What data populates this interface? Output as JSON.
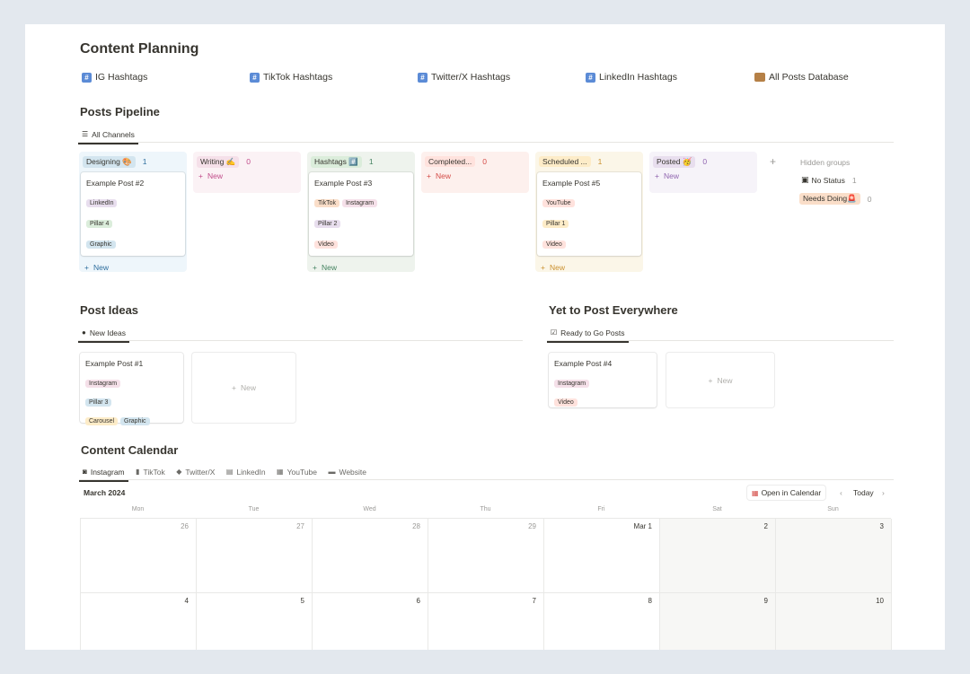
{
  "page_title": "Content Planning",
  "hashtag_links": [
    {
      "label": "IG Hashtags",
      "icon": "hashtag-icon"
    },
    {
      "label": "TikTok Hashtags",
      "icon": "hashtag-icon"
    },
    {
      "label": "Twitter/X Hashtags",
      "icon": "hashtag-icon"
    },
    {
      "label": "LinkedIn Hashtags",
      "icon": "hashtag-icon"
    },
    {
      "label": "All Posts Database",
      "icon": "card-file-box-icon"
    }
  ],
  "pipeline": {
    "title": "Posts Pipeline",
    "view_tab": "All Channels",
    "columns": [
      {
        "label": "Designing 🎨",
        "count": "1",
        "bg": "#eef6fb",
        "pill": "#d3e5ef",
        "color": "#2e6e9e",
        "cards": [
          {
            "title": "Example Post #2",
            "tags": [
              {
                "text": "LinkedIn",
                "bg": "#e8deee"
              },
              {
                "text": "Pillar 4",
                "bg": "#dbeddb"
              },
              {
                "text": "Graphic",
                "bg": "#d3e5ef"
              }
            ]
          }
        ]
      },
      {
        "label": "Writing ✍️",
        "count": "0",
        "bg": "#fbf2f5",
        "pill": "#f5e0e9",
        "color": "#c14c8a",
        "cards": []
      },
      {
        "label": "Hashtags #️⃣",
        "count": "1",
        "bg": "#eef3ed",
        "pill": "#dbeddb",
        "color": "#448361",
        "cards": [
          {
            "title": "Example Post #3",
            "tags": [
              {
                "text": "TikTok",
                "bg": "#fadec9"
              },
              {
                "text": "Instagram",
                "bg": "#f5e0e9"
              },
              {
                "text": "Pillar 2",
                "bg": "#e8deee"
              },
              {
                "text": "Video",
                "bg": "#ffe2dd"
              }
            ]
          }
        ]
      },
      {
        "label": "Completed...",
        "count": "0",
        "bg": "#fdf0ed",
        "pill": "#ffe2dd",
        "color": "#d44c47",
        "cards": []
      },
      {
        "label": "Scheduled ...",
        "count": "1",
        "bg": "#fbf6e8",
        "pill": "#fdecc8",
        "color": "#cb912f",
        "cards": [
          {
            "title": "Example Post #5",
            "tags": [
              {
                "text": "YouTube",
                "bg": "#ffe2dd"
              },
              {
                "text": "Pillar 1",
                "bg": "#fdecc8"
              },
              {
                "text": "Video",
                "bg": "#ffe2dd"
              }
            ]
          }
        ]
      },
      {
        "label": "Posted 🥳",
        "count": "0",
        "bg": "#f6f3f9",
        "pill": "#e8deee",
        "color": "#9065b0",
        "cards": []
      }
    ],
    "new_label": "New",
    "add_group": "+",
    "hidden_groups": {
      "title": "Hidden groups",
      "items": [
        {
          "label": "No Status",
          "count": "1"
        },
        {
          "label": "Needs Doing🚨",
          "count": "0"
        }
      ]
    }
  },
  "post_ideas": {
    "title": "Post Ideas",
    "view_tab": "New Ideas",
    "card": {
      "title": "Example Post #1",
      "tags": [
        {
          "text": "Instagram",
          "bg": "#f5e0e9"
        },
        {
          "text": "Pillar 3",
          "bg": "#d3e5ef"
        },
        {
          "text": "Carousel",
          "bg": "#fdecc8"
        },
        {
          "text": "Graphic",
          "bg": "#d3e5ef"
        }
      ]
    },
    "new_label": "New"
  },
  "yet_to_post": {
    "title": "Yet to Post Everywhere",
    "view_tab": "Ready to Go Posts",
    "card": {
      "title": "Example Post #4",
      "tags": [
        {
          "text": "Instagram",
          "bg": "#f5e0e9"
        },
        {
          "text": "Video",
          "bg": "#ffe2dd"
        }
      ]
    },
    "new_label": "New"
  },
  "calendar": {
    "title": "Content Calendar",
    "tabs": [
      {
        "label": "Instagram",
        "icon": "camera-icon"
      },
      {
        "label": "TikTok",
        "icon": "phone-icon"
      },
      {
        "label": "Twitter/X",
        "icon": "speech-bubbles-icon"
      },
      {
        "label": "LinkedIn",
        "icon": "briefcase-icon"
      },
      {
        "label": "YouTube",
        "icon": "film-icon"
      },
      {
        "label": "Website",
        "icon": "laptop-icon"
      }
    ],
    "month": "March 2024",
    "open_in_calendar": "Open in Calendar",
    "today": "Today",
    "prev": "‹",
    "next": "›",
    "days_of_week": [
      "Mon",
      "Tue",
      "Wed",
      "Thu",
      "Fri",
      "Sat",
      "Sun"
    ],
    "weeks": [
      [
        "26",
        "27",
        "28",
        "29",
        "Mar 1",
        "2",
        "3"
      ],
      [
        "4",
        "5",
        "6",
        "7",
        "8",
        "9",
        "10"
      ]
    ]
  }
}
